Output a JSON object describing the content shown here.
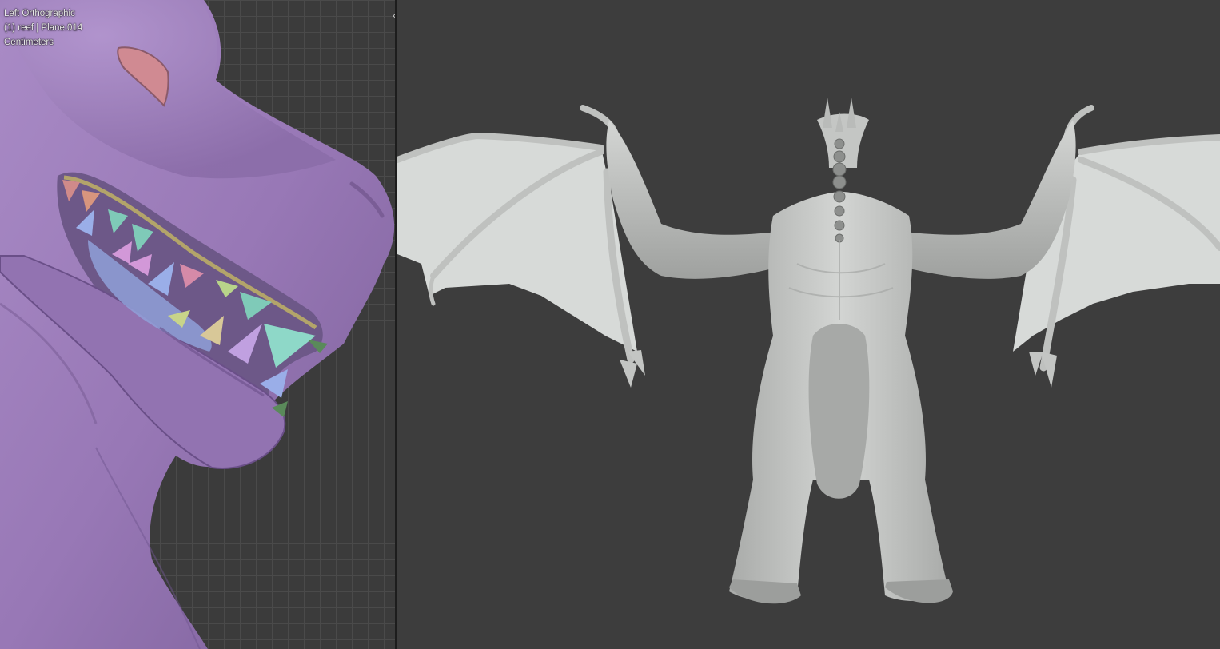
{
  "left_viewport": {
    "view_name": "Left Orthographic",
    "object_info": "(1) reef | Plane.014",
    "units": "Centimeters",
    "model": "dragon-head-closeup"
  },
  "right_viewport": {
    "model": "dragon-body-front"
  },
  "split_handle": {
    "icon": "split-arrows-icon",
    "glyph": "‹›"
  },
  "colors": {
    "viewport_bg": "#3d3d3d",
    "divider": "#1d1d1d",
    "dragon_skin": "#9a7cb8",
    "clay_model": "#c9cbc9",
    "wing_membrane": "#d9dcda"
  }
}
